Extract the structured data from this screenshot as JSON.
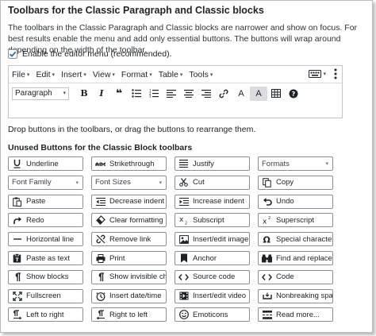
{
  "title": "Toolbars for the Classic Paragraph and Classic blocks",
  "description": "The toolbars in the Classic Paragraph and Classic blocks are narrower and show on focus. For best results enable the menu and add only essential buttons. The buttons will wrap around depending on the width of the toolbar.",
  "editor_menu_checkbox": {
    "label": "Enable the editor menu (recommended).",
    "checked": true
  },
  "menubar": [
    "File",
    "Edit",
    "Insert",
    "View",
    "Format",
    "Table",
    "Tools"
  ],
  "toolbar": {
    "format_select": "Paragraph"
  },
  "hint": "Drop buttons in the toolbars, or drag the buttons to rearrange them.",
  "unused_title": "Unused Buttons for the Classic Block toolbars",
  "unused_buttons": [
    {
      "label": "Underline",
      "icon": "underline-icon"
    },
    {
      "label": "Strikethrough",
      "icon": "strikethrough-icon"
    },
    {
      "label": "Justify",
      "icon": "align-justify-icon"
    },
    {
      "label": "Formats",
      "icon": "",
      "select": true
    },
    {
      "label": "Font Family",
      "icon": "",
      "select": true
    },
    {
      "label": "Font Sizes",
      "icon": "",
      "select": true
    },
    {
      "label": "Cut",
      "icon": "scissors-icon"
    },
    {
      "label": "Copy",
      "icon": "copy-icon"
    },
    {
      "label": "Paste",
      "icon": "paste-icon"
    },
    {
      "label": "Decrease indent",
      "icon": "outdent-icon"
    },
    {
      "label": "Increase indent",
      "icon": "indent-icon"
    },
    {
      "label": "Undo",
      "icon": "undo-icon"
    },
    {
      "label": "Redo",
      "icon": "redo-icon"
    },
    {
      "label": "Clear formatting",
      "icon": "eraser-icon"
    },
    {
      "label": "Subscript",
      "icon": "subscript-icon"
    },
    {
      "label": "Superscript",
      "icon": "superscript-icon"
    },
    {
      "label": "Horizontal line",
      "icon": "horizontal-line-icon"
    },
    {
      "label": "Remove link",
      "icon": "unlink-icon"
    },
    {
      "label": "Insert/edit image",
      "icon": "image-icon"
    },
    {
      "label": "Special character",
      "icon": "omega-icon"
    },
    {
      "label": "Paste as text",
      "icon": "paste-text-icon"
    },
    {
      "label": "Print",
      "icon": "print-icon"
    },
    {
      "label": "Anchor",
      "icon": "bookmark-icon"
    },
    {
      "label": "Find and replace",
      "icon": "binoculars-icon"
    },
    {
      "label": "Show blocks",
      "icon": "pilcrow-icon"
    },
    {
      "label": "Show invisible char...",
      "icon": "pilcrow-icon"
    },
    {
      "label": "Source code",
      "icon": "code-icon"
    },
    {
      "label": "Code",
      "icon": "code-icon"
    },
    {
      "label": "Fullscreen",
      "icon": "fullscreen-icon"
    },
    {
      "label": "Insert date/time",
      "icon": "clock-icon"
    },
    {
      "label": "Insert/edit video",
      "icon": "video-icon"
    },
    {
      "label": "Nonbreaking space",
      "icon": "nbsp-icon"
    },
    {
      "label": "Left to right",
      "icon": "ltr-icon"
    },
    {
      "label": "Right to left",
      "icon": "rtl-icon"
    },
    {
      "label": "Emoticons",
      "icon": "smiley-icon"
    },
    {
      "label": "Read more...",
      "icon": "read-more-icon"
    }
  ]
}
